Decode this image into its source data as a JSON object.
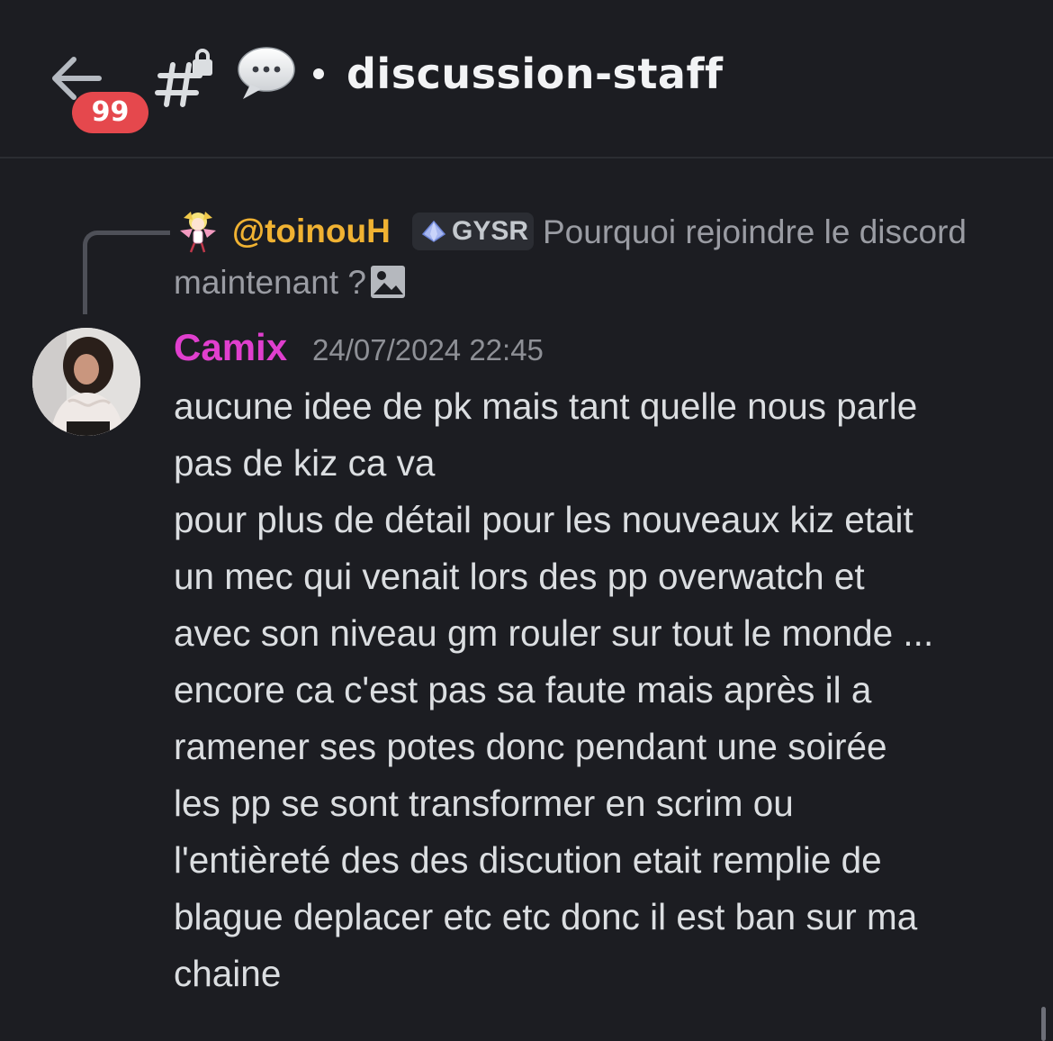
{
  "header": {
    "back_label": "back",
    "unread_badge": "99",
    "channel_prefix_separator": "•",
    "channel_name": "discussion-staff",
    "icons": [
      "arrow-left-icon",
      "locked-hash-icon",
      "speech-bubble-icon"
    ]
  },
  "reply": {
    "author": "@toinouH",
    "role_tag": "GYSR",
    "preview_text": "Pourquoi rejoindre le discord maintenant ?",
    "attachment_icon": "image-icon"
  },
  "message": {
    "author": "Camix",
    "timestamp": "24/07/2024 22:45",
    "lines": [
      "aucune idee de pk mais tant quelle nous parle",
      "pas de kiz ca va",
      "pour plus de détail pour les nouveaux kiz etait",
      "un mec qui venait lors des pp overwatch et",
      "avec son niveau gm rouler sur tout le monde ...",
      "encore ca c'est pas sa faute mais après il a",
      "ramener ses potes donc pendant une soirée",
      "les pp se sont transformer en scrim ou",
      "l'entièreté des des discution etait remplie de",
      "blague deplacer etc etc donc il est ban sur ma",
      "chaine"
    ]
  },
  "colors": {
    "background": "#1c1d22",
    "author_color": "#e03fce",
    "reply_author_color": "#f0b232",
    "badge_red": "#e5484d",
    "text": "#dbdee1",
    "muted": "#9a9ca3"
  }
}
